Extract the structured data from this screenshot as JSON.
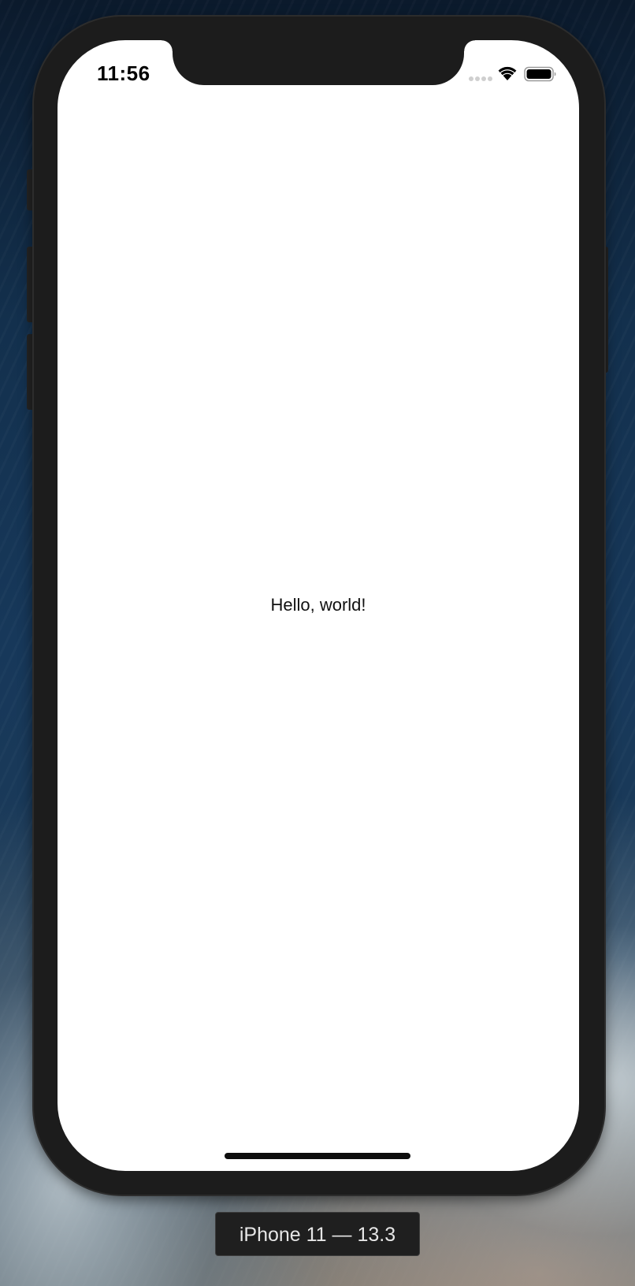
{
  "status_bar": {
    "time": "11:56",
    "icons": [
      "cellular-signal-icon",
      "wifi-icon",
      "battery-icon"
    ]
  },
  "app": {
    "content_text": "Hello, world!"
  },
  "simulator": {
    "device_label": "iPhone 11 — 13.3"
  },
  "colors": {
    "screen_background": "#ffffff",
    "device_frame": "#1c1c1c",
    "label_background": "#1f1f1f"
  }
}
